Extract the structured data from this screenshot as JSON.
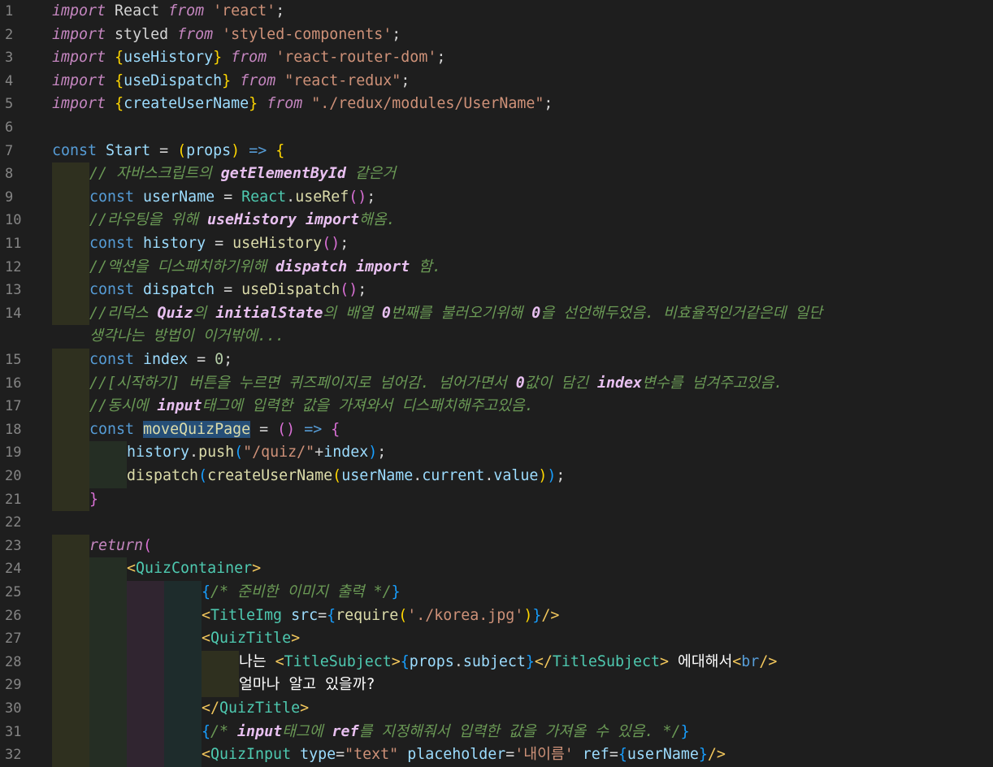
{
  "editor": {
    "lines": [
      {
        "n": "1",
        "text": "import React from 'react';"
      },
      {
        "n": "2",
        "text": "import styled from 'styled-components';"
      },
      {
        "n": "3",
        "text": "import {useHistory} from 'react-router-dom';"
      },
      {
        "n": "4",
        "text": "import {useDispatch} from \"react-redux\";"
      },
      {
        "n": "5",
        "text": "import {createUserName} from \"./redux/modules/UserName\";"
      },
      {
        "n": "6",
        "text": ""
      },
      {
        "n": "7",
        "text": "const Start = (props) => {"
      },
      {
        "n": "8",
        "text": "// 자바스크립트의 getElementById 같은거"
      },
      {
        "n": "9",
        "text": "const userName = React.useRef();"
      },
      {
        "n": "10",
        "text": "//라우팅을 위해 useHistory import해옴."
      },
      {
        "n": "11",
        "text": "const history = useHistory();"
      },
      {
        "n": "12",
        "text": "//액션을 디스패치하기위해 dispatch import 함."
      },
      {
        "n": "13",
        "text": "const dispatch = useDispatch();"
      },
      {
        "n": "14",
        "text": "//리덕스 Quiz의 initialState의 배열 0번째를 불러오기위해 0을 선언해두었음. 비효율적인거같은데 일단"
      },
      {
        "n": "",
        "text": "생각나는 방법이 이거밖에..."
      },
      {
        "n": "15",
        "text": "const index = 0;"
      },
      {
        "n": "16",
        "text": "//[시작하기] 버튼을 누르면 퀴즈페이지로 넘어감. 넘어가면서 0값이 담긴 index변수를 넘겨주고있음."
      },
      {
        "n": "17",
        "text": "//동시에 input태그에 입력한 값을 가져와서 디스패치해주고있음."
      },
      {
        "n": "18",
        "text": "const moveQuizPage = () => {"
      },
      {
        "n": "19",
        "text": "history.push(\"/quiz/\"+index);"
      },
      {
        "n": "20",
        "text": "dispatch(createUserName(userName.current.value));"
      },
      {
        "n": "21",
        "text": "}"
      },
      {
        "n": "22",
        "text": ""
      },
      {
        "n": "23",
        "text": "return("
      },
      {
        "n": "24",
        "text": "<QuizContainer>"
      },
      {
        "n": "25",
        "text": "{/* 준비한 이미지 출력 */}"
      },
      {
        "n": "26",
        "text": "<TitleImg src={require('./korea.jpg')}/>"
      },
      {
        "n": "27",
        "text": "<QuizTitle>"
      },
      {
        "n": "28",
        "text": "나는 <TitleSubject>{props.subject}</TitleSubject> 에대해서<br/>"
      },
      {
        "n": "29",
        "text": "얼마나 알고 있을까?"
      },
      {
        "n": "30",
        "text": "</QuizTitle>"
      },
      {
        "n": "31",
        "text": "{/* input태그에 ref를 지정해줘서 입력한 값을 가져올 수 있음. */}"
      },
      {
        "n": "32",
        "text": "<QuizInput type=\"text\" placeholder='내이름' ref={userName}/>"
      }
    ]
  }
}
